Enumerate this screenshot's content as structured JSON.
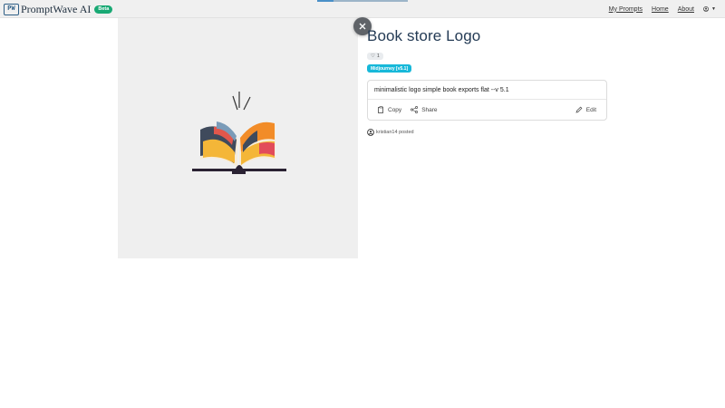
{
  "app": {
    "logo_mark": "PW",
    "name": "PromptWave AI",
    "badge": "Beta",
    "brand_color": "#2f5f86",
    "badge_color": "#19a974"
  },
  "nav": {
    "links": [
      "My Prompts",
      "Home",
      "About"
    ],
    "avatar_icon": "user-circle-icon",
    "caret_icon": "caret-down-icon"
  },
  "prompt": {
    "title": "Book store Logo",
    "likes": "1",
    "model": "Midjourney [v5.1]",
    "model_color": "#17b8d9",
    "text": "minimalistic logo simple book exports flat --v 5.1",
    "actions": {
      "copy": "Copy",
      "share": "Share",
      "edit": "Edit"
    },
    "posted_by": "kristian14 posted"
  },
  "image": {
    "description_icon": "book-logo-image",
    "close_icon": "close-icon"
  }
}
